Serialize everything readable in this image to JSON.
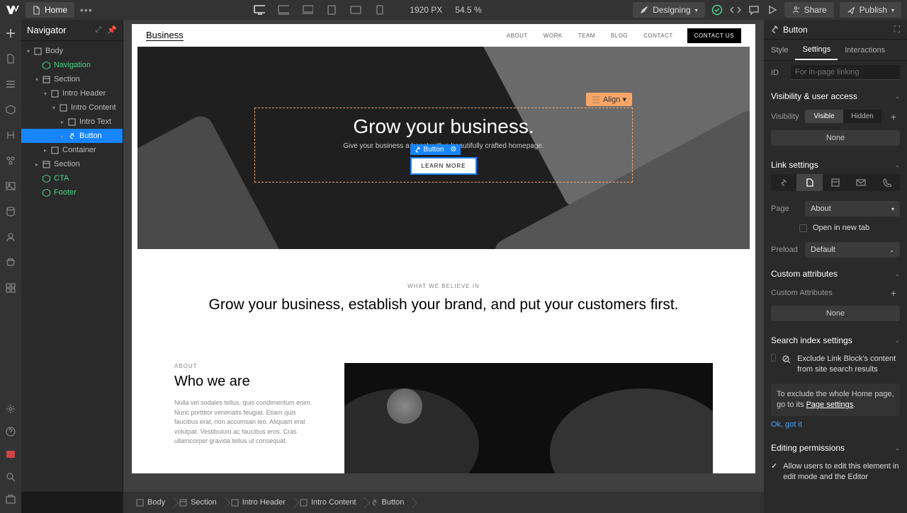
{
  "topbar": {
    "page": "Home",
    "viewport": "1920 PX",
    "zoom": "54.5 %",
    "mode": "Designing",
    "share": "Share",
    "publish": "Publish"
  },
  "navigator": {
    "title": "Navigator",
    "items": [
      {
        "label": "Body",
        "indent": 0,
        "icon": "body",
        "caret": true
      },
      {
        "label": "Navigation",
        "indent": 1,
        "icon": "comp",
        "green": true
      },
      {
        "label": "Section",
        "indent": 1,
        "icon": "section",
        "caret": true
      },
      {
        "label": "Intro Header",
        "indent": 2,
        "icon": "div",
        "caret": true
      },
      {
        "label": "Intro Content",
        "indent": 3,
        "icon": "div",
        "caret": true
      },
      {
        "label": "Intro Text",
        "indent": 4,
        "icon": "div",
        "caretr": true
      },
      {
        "label": "Button",
        "indent": 4,
        "icon": "link",
        "caretr": true,
        "selected": true
      },
      {
        "label": "Container",
        "indent": 2,
        "icon": "div",
        "caretr": true
      },
      {
        "label": "Section",
        "indent": 1,
        "icon": "section",
        "caretr": true
      },
      {
        "label": "CTA",
        "indent": 1,
        "icon": "comp",
        "green": true
      },
      {
        "label": "Footer",
        "indent": 1,
        "icon": "comp",
        "green": true
      }
    ]
  },
  "site": {
    "brand": "Business",
    "nav": [
      "ABOUT",
      "WORK",
      "TEAM",
      "BLOG",
      "CONTACT"
    ],
    "contact_btn": "CONTACT US",
    "hero": {
      "align_label": "Align ▾",
      "title": "Grow your business.",
      "sub": "Give your business a boost with a beautifully crafted homepage.",
      "btn_badge": "Button",
      "btn": "LEARN MORE"
    },
    "section2": {
      "tagline": "WHAT WE BELIEVE IN",
      "title": "Grow your business, establish your brand, and put your customers first."
    },
    "about": {
      "label": "ABOUT",
      "title": "Who we are",
      "body": "Nulla vel sodales tellus, quis condimentum enim. Nunc porttitor venenatis feugiat. Etiam quis faucibus erat, non accumsan leo. Aliquam erat volutpat. Vestibulum ac faucibus eros. Cras ullamcorper gravida tellus ut consequat."
    }
  },
  "breadcrumb": [
    "Body",
    "Section",
    "Intro Header",
    "Intro Content",
    "Button"
  ],
  "right": {
    "element": "Button",
    "tabs": [
      "Style",
      "Settings",
      "Interactions"
    ],
    "id_label": "ID",
    "id_placeholder": "For in-page linking",
    "visibility": {
      "title": "Visibility & user access",
      "label": "Visibility",
      "options": [
        "Visible",
        "Hidden"
      ],
      "none": "None"
    },
    "link": {
      "title": "Link settings",
      "page_label": "Page",
      "page_value": "About",
      "open_new": "Open in new tab",
      "preload_label": "Preload",
      "preload_value": "Default"
    },
    "custom_attr": {
      "title": "Custom attributes",
      "label": "Custom Attributes",
      "none": "None"
    },
    "search": {
      "title": "Search index settings",
      "exclude": "Exclude Link Block's content from site search results",
      "note_a": "To exclude the whole Home page, go to its ",
      "note_b": "Page settings",
      "ok": "Ok, got it"
    },
    "perm": {
      "title": "Editing permissions",
      "text": "Allow users to edit this element in edit mode and the Editor"
    }
  }
}
